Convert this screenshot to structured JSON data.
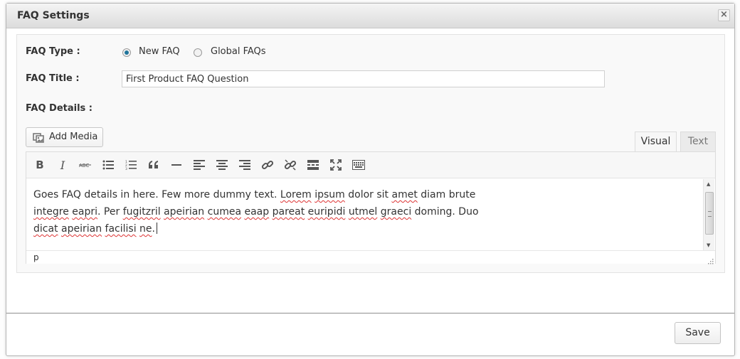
{
  "dialog": {
    "title": "FAQ Settings",
    "close_label": "×"
  },
  "form": {
    "faq_type_label": "FAQ Type :",
    "faq_type_options": [
      {
        "label": "New FAQ",
        "checked": true
      },
      {
        "label": "Global FAQs",
        "checked": false
      }
    ],
    "faq_title_label": "FAQ Title :",
    "faq_title_value": "First Product FAQ Question",
    "faq_details_label": "FAQ Details :"
  },
  "editor": {
    "add_media_label": "Add Media",
    "tabs": [
      {
        "label": "Visual",
        "active": true
      },
      {
        "label": "Text",
        "active": false
      }
    ],
    "toolbar_icons": [
      "bold-icon",
      "italic-icon",
      "strikethrough-icon",
      "bullet-list-icon",
      "numbered-list-icon",
      "blockquote-icon",
      "horizontal-rule-icon",
      "align-left-icon",
      "align-center-icon",
      "align-right-icon",
      "insert-link-icon",
      "remove-link-icon",
      "read-more-icon",
      "fullscreen-icon",
      "toolbar-toggle-icon"
    ],
    "content_lines": [
      [
        "Goes FAQ details in here. Few more dummy text. ",
        "Lorem",
        " ",
        "ipsum",
        " dolor sit ",
        "amet",
        " diam brute"
      ],
      [
        "integre",
        " ",
        "eapri",
        ". Per ",
        "fugitzril",
        " ",
        "apeirian",
        " ",
        "cumea",
        " ",
        "eaap",
        " ",
        "pareat",
        " ",
        "euripidi",
        " ",
        "utmel",
        " ",
        "graeci",
        " doming. Duo"
      ],
      [
        "dicat",
        " ",
        "apeirian",
        " ",
        "facilisi",
        " ",
        "ne",
        "."
      ]
    ],
    "status_path": "p"
  },
  "footer": {
    "save_label": "Save"
  },
  "colors": {
    "accent": "#21759b",
    "spellcheck": "#dd3333"
  }
}
